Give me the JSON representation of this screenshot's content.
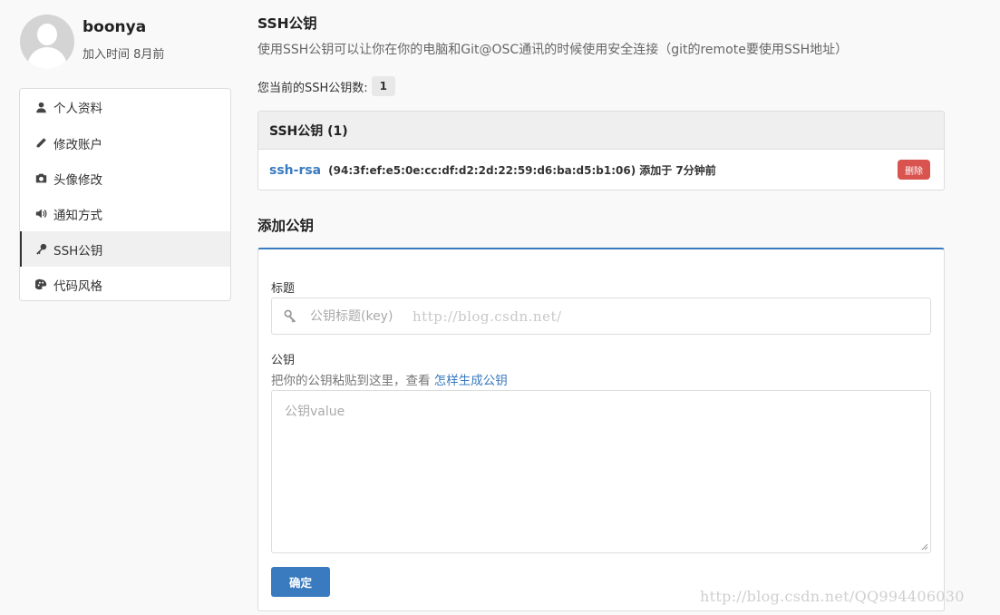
{
  "profile": {
    "username": "boonya",
    "joined": "加入时间 8月前"
  },
  "sidebar": {
    "items": [
      {
        "label": "个人资料",
        "icon": "user-icon",
        "active": false
      },
      {
        "label": "修改账户",
        "icon": "pencil-icon",
        "active": false
      },
      {
        "label": "头像修改",
        "icon": "camera-icon",
        "active": false
      },
      {
        "label": "通知方式",
        "icon": "volume-icon",
        "active": false
      },
      {
        "label": "SSH公钥",
        "icon": "key-icon",
        "active": true
      },
      {
        "label": "代码风格",
        "icon": "palette-icon",
        "active": false
      }
    ]
  },
  "ssh": {
    "title": "SSH公钥",
    "description": "使用SSH公钥可以让你在你的电脑和Git@OSC通讯的时候使用安全连接（git的remote要使用SSH地址）",
    "count_label": "您当前的SSH公钥数:",
    "count": "1",
    "panel_title": "SSH公钥 (1)",
    "keys": [
      {
        "type": "ssh-rsa",
        "fingerprint": "(94:3f:ef:e5:0e:cc:df:d2:2d:22:59:d6:ba:d5:b1:06)",
        "added": "添加于 7分钟前",
        "delete_label": "删除"
      }
    ]
  },
  "add": {
    "title": "添加公钥",
    "title_label": "标题",
    "title_placeholder": "公钥标题(key)",
    "key_label": "公钥",
    "help_text": "把你的公钥粘贴到这里，查看",
    "help_link": "怎样生成公钥",
    "key_placeholder": "公钥value",
    "submit_label": "确定"
  },
  "watermarks": {
    "inline": "http://blog.csdn.net/",
    "corner": "http://blog.csdn.net/QQ994406030"
  },
  "colors": {
    "accent": "#3a7bbf",
    "danger": "#d9534f"
  }
}
